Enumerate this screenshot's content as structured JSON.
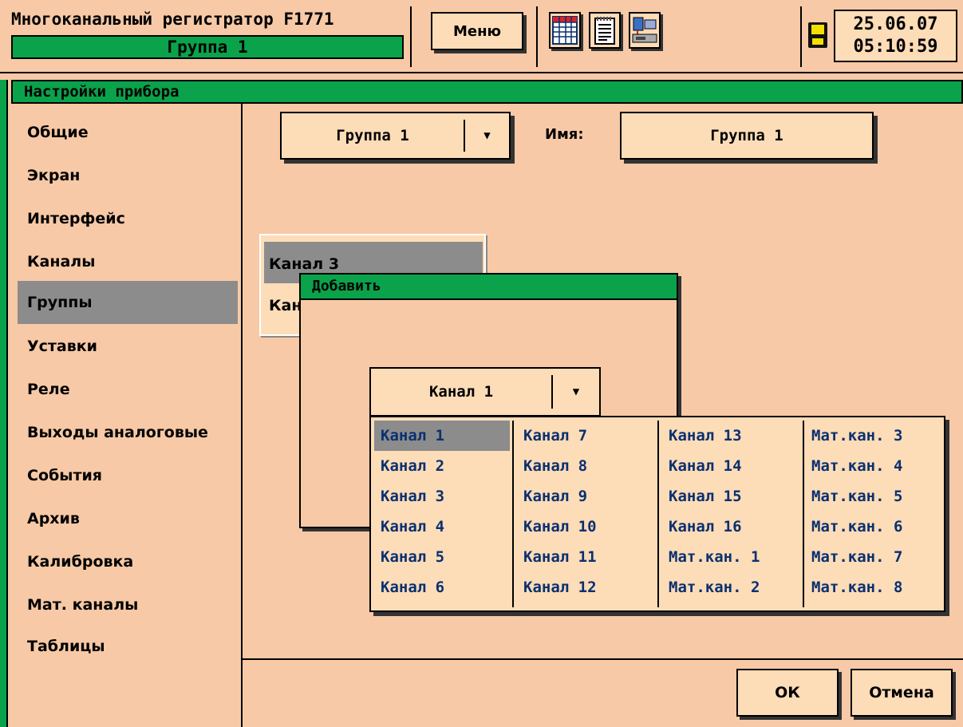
{
  "header": {
    "title": "Многоканальный регистратор F1771",
    "group_name": "Группа 1",
    "menu_label": "Меню",
    "icons": [
      "table-icon",
      "document-icon",
      "computer-network-icon",
      "floppy-disk-icon"
    ],
    "date": "25.06.07",
    "time": "05:10:59"
  },
  "panel": {
    "title": "Настройки прибора"
  },
  "sidebar": {
    "items": [
      {
        "label": "Общие"
      },
      {
        "label": "Экран"
      },
      {
        "label": "Интерфейс"
      },
      {
        "label": "Каналы"
      },
      {
        "label": "Группы",
        "selected": true
      },
      {
        "label": "Уставки"
      },
      {
        "label": "Реле"
      },
      {
        "label": "Выходы аналоговые"
      },
      {
        "label": "События"
      },
      {
        "label": "Архив"
      },
      {
        "label": "Калибровка"
      },
      {
        "label": "Мат. каналы"
      },
      {
        "label": "Таблицы"
      }
    ]
  },
  "group_select": {
    "value": "Группа 1",
    "arrow": "▼"
  },
  "name_field": {
    "label": "Имя:",
    "value": "Группа 1"
  },
  "channel_list": {
    "items": [
      "Канал 3",
      "Кан"
    ]
  },
  "add_dialog": {
    "title": "Добавить",
    "select": {
      "value": "Канал 1",
      "arrow": "▼"
    },
    "columns": [
      [
        "Канал 1",
        "Канал 2",
        "Канал 3",
        "Канал 4",
        "Канал 5",
        "Канал 6"
      ],
      [
        "Канал 7",
        "Канал 8",
        "Канал 9",
        "Канал 10",
        "Канал 11",
        "Канал 12"
      ],
      [
        "Канал 13",
        "Канал 14",
        "Канал 15",
        "Канал 16",
        "Мат.кан. 1",
        "Мат.кан. 2"
      ],
      [
        "Мат.кан. 3",
        "Мат.кан. 4",
        "Мат.кан. 5",
        "Мат.кан. 6",
        "Мат.кан. 7",
        "Мат.кан. 8"
      ]
    ],
    "selected": "Канал 1"
  },
  "footer": {
    "ok_label": "ОК",
    "cancel_label": "Отмена"
  },
  "colors": {
    "background": "#f7c9a6",
    "panel_fill": "#fddcb8",
    "title_green": "#0aa24a",
    "selection_gray": "#8c8c8c",
    "list_text_blue": "#0a3070"
  }
}
